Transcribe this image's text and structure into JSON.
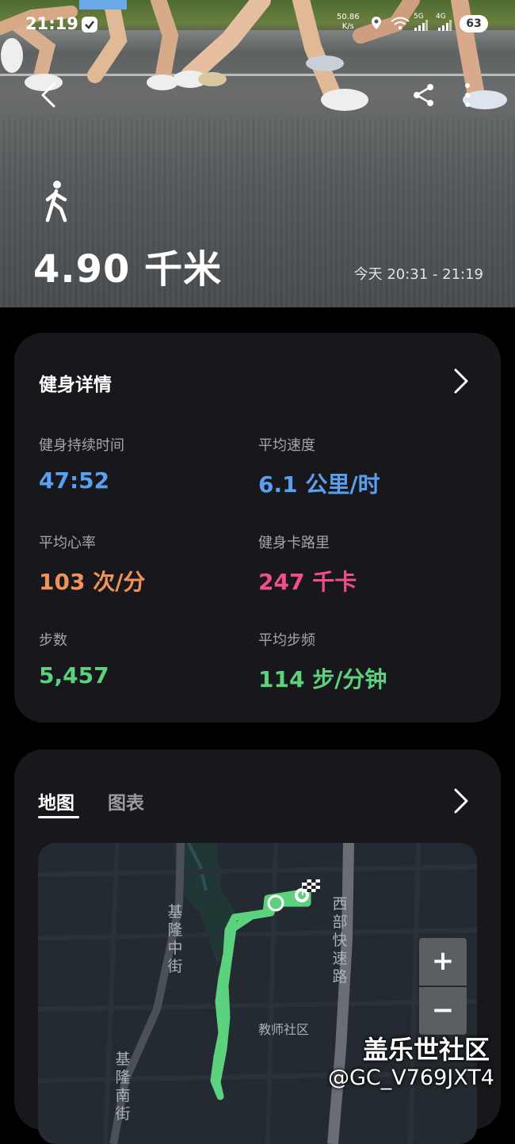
{
  "status_bar": {
    "time": "21:19",
    "net_speed_value": "50.86",
    "net_speed_unit": "K/s",
    "signal_5g": "5G",
    "signal_4g": "4G",
    "battery": "63"
  },
  "hero": {
    "distance": "4.90 千米",
    "time_range": "今天 20:31 - 21:19"
  },
  "details": {
    "title": "健身详情",
    "metrics": [
      {
        "label": "健身持续时间",
        "value": "47:52",
        "color": "#5aa0f0"
      },
      {
        "label": "平均速度",
        "value": "6.1 公里/时",
        "color": "#5aa0f0"
      },
      {
        "label": "平均心率",
        "value": "103 次/分",
        "color": "#f0935a"
      },
      {
        "label": "健身卡路里",
        "value": "247 千卡",
        "color": "#f0508a"
      },
      {
        "label": "步数",
        "value": "5,457",
        "color": "#5cd27e"
      },
      {
        "label": "平均步频",
        "value": "114 步/分钟",
        "color": "#5cd27e"
      }
    ]
  },
  "map_card": {
    "tabs": [
      "地图",
      "图表"
    ],
    "streets": {
      "left_upper": "基隆中街",
      "left_lower": "基隆南街",
      "right": "西部快速路"
    },
    "poi": "教师社区",
    "zoom_in": "+",
    "zoom_out": "−",
    "route_color": "#5cd27e"
  },
  "watermark": {
    "line1": "盖乐世社区",
    "line2": "@GC_V769JXT4"
  }
}
